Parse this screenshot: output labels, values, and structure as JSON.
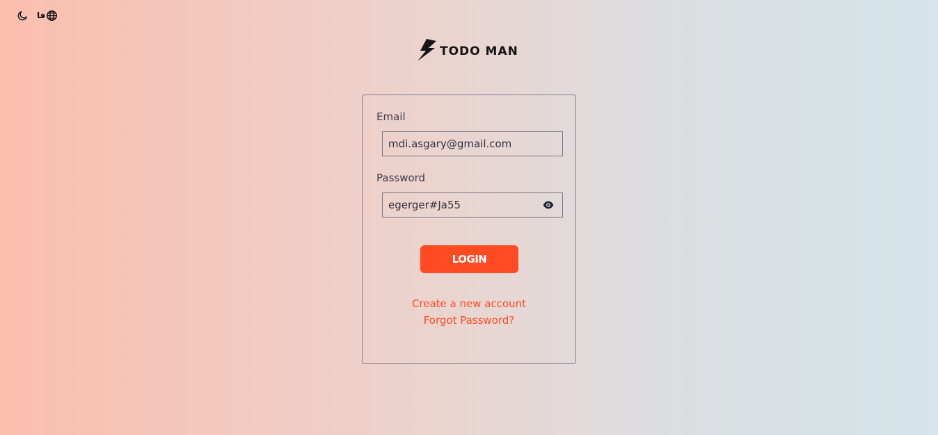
{
  "topbar": {
    "theme_icon": "moon-icon",
    "language_label": "فا",
    "language_icon": "globe-icon"
  },
  "logo": {
    "icon": "lightning-bolt-logo",
    "text": "TODO MAN"
  },
  "login_form": {
    "email_label": "Email",
    "email_value": "mdi.asgary@gmail.com",
    "password_label": "Password",
    "password_value": "egerger#Ja55",
    "password_toggle_icon": "eye-icon",
    "login_button_label": "LOGIN",
    "create_account_link": "Create a new account",
    "forgot_password_link": "Forgot Password?"
  },
  "colors": {
    "accent": "#ff4a22",
    "border": "#7d7f92",
    "text": "#3d3d4d"
  }
}
